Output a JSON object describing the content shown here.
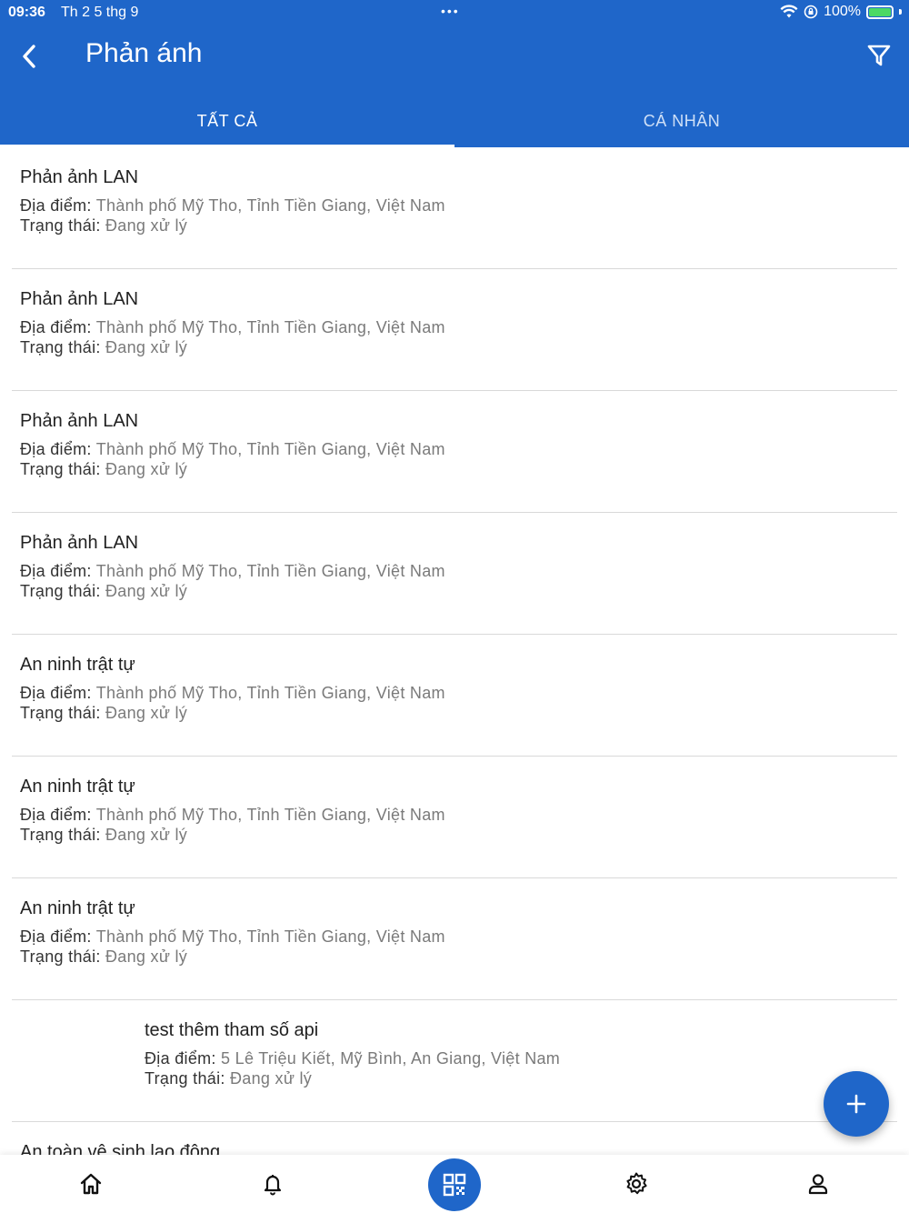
{
  "status_bar": {
    "time": "09:36",
    "date": "Th 2 5 thg 9",
    "dots": "•••",
    "battery_pct": "100%",
    "battery_level": 1.0
  },
  "header": {
    "title": "Phản ánh",
    "back_icon": "chevron-left-icon",
    "filter_icon": "filter-icon"
  },
  "tabs": [
    {
      "label": "TẤT CẢ",
      "active": true
    },
    {
      "label": "CÁ NHÂN",
      "active": false
    }
  ],
  "labels": {
    "location": "Địa điểm:",
    "status": "Trạng thái:"
  },
  "items": [
    {
      "title": "Phản ảnh LAN",
      "location": "Thành phố Mỹ Tho, Tỉnh Tiền Giang, Việt Nam",
      "status": "Đang xử lý"
    },
    {
      "title": "Phản ảnh LAN",
      "location": "Thành phố Mỹ Tho, Tỉnh Tiền Giang, Việt Nam",
      "status": "Đang xử lý"
    },
    {
      "title": "Phản ảnh LAN",
      "location": "Thành phố Mỹ Tho, Tỉnh Tiền Giang, Việt Nam",
      "status": "Đang xử lý"
    },
    {
      "title": "Phản ảnh LAN",
      "location": "Thành phố Mỹ Tho, Tỉnh Tiền Giang, Việt Nam",
      "status": "Đang xử lý"
    },
    {
      "title": "An ninh trật tự",
      "location": "Thành phố Mỹ Tho, Tỉnh Tiền Giang, Việt Nam",
      "status": "Đang xử lý"
    },
    {
      "title": "An ninh trật tự",
      "location": "Thành phố Mỹ Tho, Tỉnh Tiền Giang, Việt Nam",
      "status": "Đang xử lý"
    },
    {
      "title": "An ninh trật tự",
      "location": "Thành phố Mỹ Tho, Tỉnh Tiền Giang, Việt Nam",
      "status": "Đang xử lý"
    },
    {
      "title": "test thêm tham số api",
      "location": "5 Lê Triệu Kiết, Mỹ Bình, An Giang, Việt Nam",
      "status": "Đang xử lý"
    },
    {
      "title": "An toàn vệ sinh lao động",
      "location": "",
      "status": ""
    }
  ],
  "fab_icon": "plus-icon",
  "bottom_nav": [
    {
      "icon": "home-icon"
    },
    {
      "icon": "bell-icon"
    },
    {
      "icon": "qr-code-icon"
    },
    {
      "icon": "gear-icon"
    },
    {
      "icon": "user-icon"
    }
  ],
  "colors": {
    "primary": "#1f66c9",
    "text": "#222222",
    "muted": "#7a7a7a",
    "divider": "#d9d9d9"
  }
}
